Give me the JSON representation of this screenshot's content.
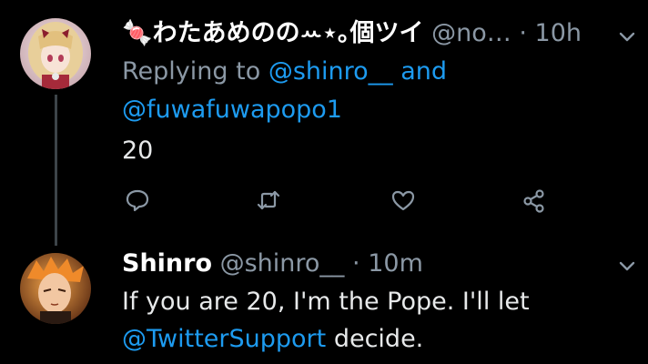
{
  "tweets": [
    {
      "name": "🍬わたあめののꕀ⋆｡個ツイ",
      "handle": "@no…",
      "separator": "·",
      "time": "10h",
      "replying_prefix": "Replying to",
      "reply_to_1": "@shinro__",
      "reply_to_and": "and",
      "reply_to_2": "@fuwafuwapopo1",
      "body": "20",
      "avatar": "anime-girl-avatar"
    },
    {
      "name": "Shinro",
      "handle": "@shinro__",
      "separator": "·",
      "time": "10m",
      "body_line1": "If you are 20, I'm the Pope. I'll let",
      "mention": "@TwitterSupport",
      "body_line2_rest": "decide.",
      "avatar": "anime-boy-avatar"
    }
  ],
  "actions": [
    "reply-icon",
    "retweet-icon",
    "like-icon",
    "share-icon"
  ],
  "colors": {
    "background": "#000000",
    "link": "#1d9bf0",
    "muted": "#8b98a5",
    "text": "#e7e9ea",
    "thread_line": "#3d4449"
  }
}
